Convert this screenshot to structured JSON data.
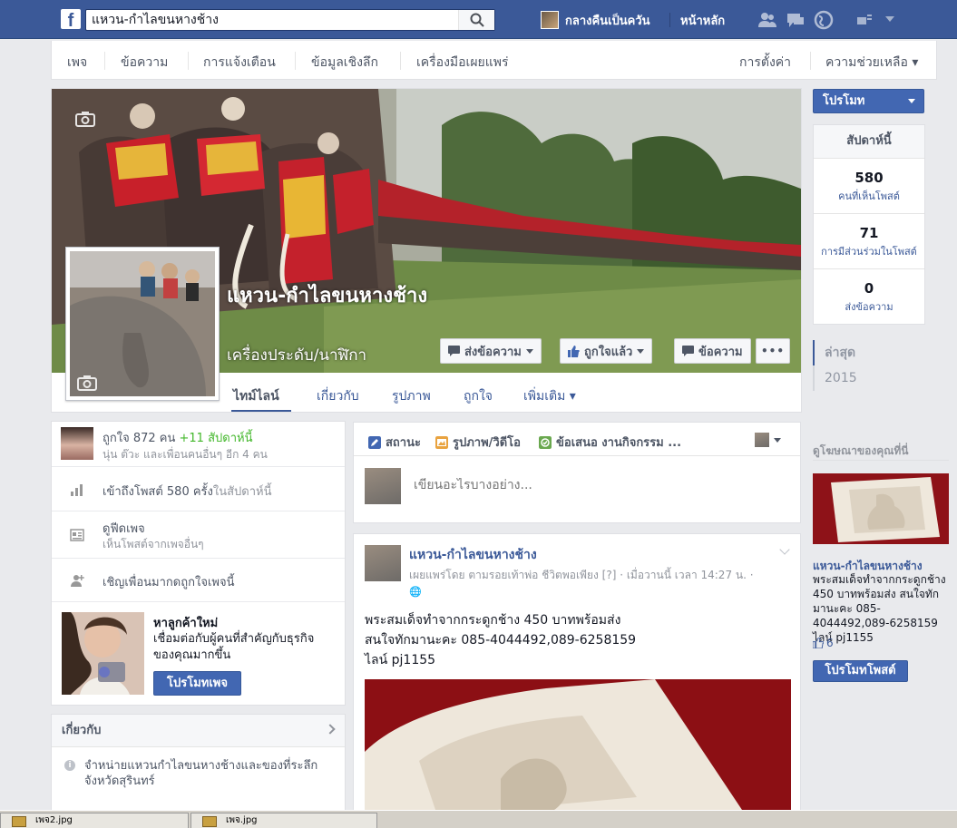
{
  "topbar": {
    "search_value": "แหวน-กำไลขนหางช้าง",
    "user_name": "กลางคืนเป็นควัน",
    "home_label": "หน้าหลัก"
  },
  "admin_nav": {
    "items": [
      "เพจ",
      "ข้อความ",
      "การแจ้งเตือน",
      "ข้อมูลเชิงลึก",
      "เครื่องมือเผยแพร่"
    ],
    "settings": "การตั้งค่า",
    "help": "ความช่วยเหลือ ▾"
  },
  "page": {
    "name": "แหวน-กำไลขนหางช้าง",
    "category": "เครื่องประดับ/นาฬิกา"
  },
  "cover_actions": {
    "message": "ส่งข้อความ",
    "liked": "ถูกใจแล้ว",
    "chat": "ข้อความ",
    "more": "•••"
  },
  "tabs": [
    "ไทม์ไลน์",
    "เกี่ยวกับ",
    "รูปภาพ",
    "ถูกใจ",
    "เพิ่มเติม"
  ],
  "right_panel": {
    "promote": "โปรโมท",
    "week_title": "สัปดาห์นี้",
    "stats": [
      {
        "num": "580",
        "label": "คนที่เห็นโพสต์"
      },
      {
        "num": "71",
        "label": "การมีส่วนร่วมในโพสต์"
      },
      {
        "num": "0",
        "label": "ส่งข้อความ"
      }
    ],
    "timeline_nav": [
      "ล่าสุด",
      "2015"
    ]
  },
  "left": {
    "likes_line": "ถูกใจ 872 คน",
    "likes_week": "+11 สัปดาห์นี้",
    "likes_friends": "นุ่น ต๊วะ และเพื่อนคนอื่นๆ อีก 4 คน",
    "reach_text": "เข้าถึงโพสต์ 580 ครั้ง",
    "reach_week": "ในสัปดาห์นี้",
    "feed_title": "ดูฟีดเพจ",
    "feed_sub": "เห็นโพสต์จากเพจอื่นๆ",
    "invite": "เชิญเพื่อนมากดถูกใจเพจนี้",
    "ad_title": "หาลูกค้าใหม่",
    "ad_desc": "เชื่อมต่อกับผู้คนที่สำคัญกับธุรกิจของคุณมากขึ้น",
    "ad_button": "โปรโมทเพจ",
    "about_title": "เกี่ยวกับ",
    "about_text": "จำหน่ายแหวนกำไลขนหางช้างและของที่ระลึกจังหวัดสุรินทร์"
  },
  "composer": {
    "status": "สถานะ",
    "photo": "รูปภาพ/วิดีโอ",
    "offer": "ข้อเสนอ งานกิจกรรม ...",
    "placeholder": "เขียนอะไรบางอย่าง..."
  },
  "post": {
    "author": "แหวน-กำไลขนหางช้าง",
    "meta": "เผยแพร่โดย ตามรอยเท้าพ่อ ชีวิตพอเพียง [?] · เมื่อวานนี้ เวลา 14:27 น. ·",
    "line1": "พระสมเด็จทำจากกระดูกช้าง 450 บาทพร้อมส่ง",
    "line2": "สนใจทักมานะคะ 085-4044492,089-6258159",
    "line3": "ไลน์ pj1155"
  },
  "right_ad": {
    "section": "ดูโฆษณาของคุณที่นี่",
    "title": "แหวน-กำไลขนหางช้าง",
    "desc": "พระสมเด็จทำจากกระดูกช้าง 450 บาทพร้อมส่ง สนใจทักมานะคะ 085-4044492,089-6258159 ไลน์ pj1155",
    "likes": "6",
    "button": "โปรโมทโพสต์"
  },
  "taskbar": {
    "items": [
      "เพจ2.jpg",
      "เพจ.jpg"
    ]
  },
  "colors": {
    "brand": "#3b5998",
    "button": "#4267b2",
    "green": "#42b72a"
  }
}
